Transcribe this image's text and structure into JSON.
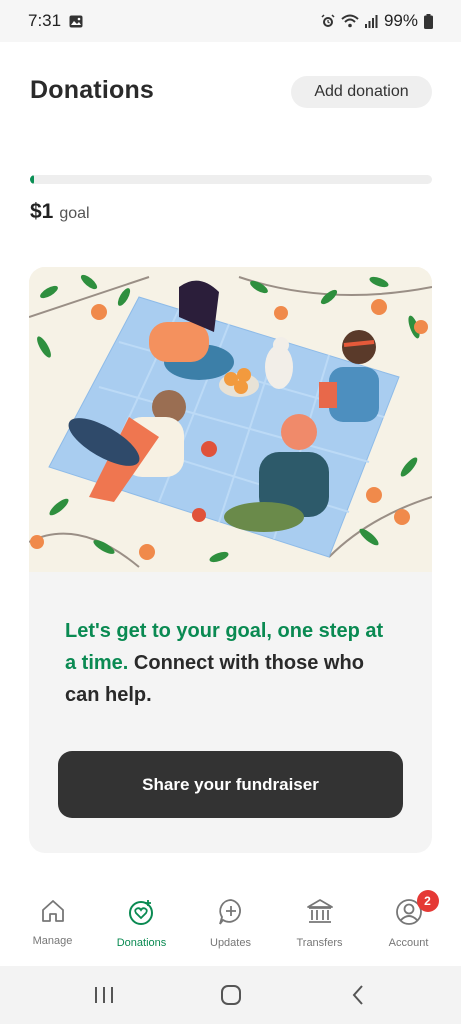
{
  "status_bar": {
    "time": "7:31",
    "battery": "99%",
    "icons": [
      "image-icon",
      "alarm-icon",
      "wifi-icon",
      "signal-icon",
      "battery-icon"
    ]
  },
  "header": {
    "title": "Donations",
    "add_button": "Add donation"
  },
  "progress": {
    "fraction": 0.01,
    "accent_color": "#0a8f55"
  },
  "goal": {
    "amount": "$1",
    "label": "goal"
  },
  "card": {
    "illustration": "picnic-illustration",
    "message_highlight": "Let's get to your goal, one step at a time.",
    "message_rest": " Connect with those who can help.",
    "share_button": "Share your fundraiser"
  },
  "nav": {
    "items": [
      {
        "label": "Manage",
        "icon": "home-icon"
      },
      {
        "label": "Donations",
        "icon": "heart-target-icon",
        "active": true
      },
      {
        "label": "Updates",
        "icon": "add-update-icon"
      },
      {
        "label": "Transfers",
        "icon": "bank-icon"
      },
      {
        "label": "Account",
        "icon": "account-icon",
        "badge": "2"
      }
    ]
  },
  "system_nav": [
    "recents-icon",
    "home-button-icon",
    "back-icon"
  ]
}
